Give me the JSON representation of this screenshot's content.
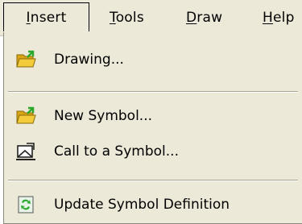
{
  "menubar": {
    "items": [
      {
        "label": "Insert",
        "accel": "I",
        "rest": "nsert"
      },
      {
        "label": "Tools",
        "accel": "T",
        "rest": "ools"
      },
      {
        "label": "Draw",
        "accel": "D",
        "rest": "raw"
      },
      {
        "label": "Help",
        "accel": "H",
        "rest": "elp"
      }
    ]
  },
  "dropdown": {
    "items": [
      {
        "label": "Drawing...",
        "icon": "folder-open-icon"
      },
      {
        "label": "New Symbol...",
        "icon": "folder-open-icon"
      },
      {
        "label": "Call to a Symbol...",
        "icon": "insert-symbol-icon"
      },
      {
        "label": "Update Symbol Definition",
        "icon": "refresh-icon"
      }
    ]
  },
  "colors": {
    "menu_bg": "#ece9d8",
    "folder": "#e8b820",
    "arrow": "#2aa82a"
  }
}
